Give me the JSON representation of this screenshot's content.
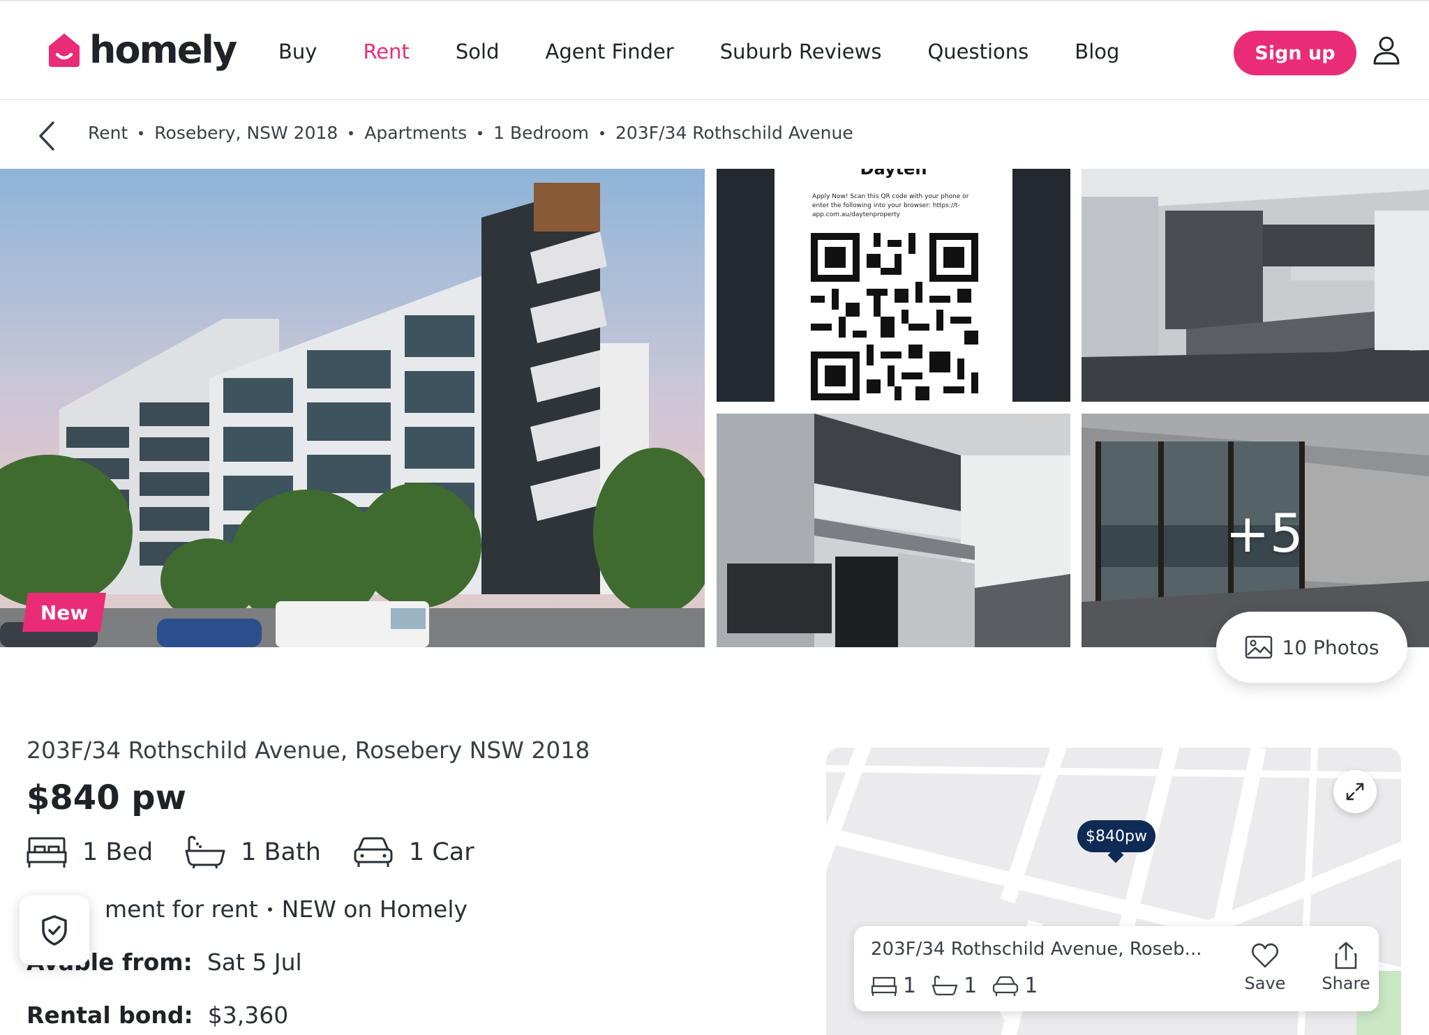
{
  "brand": {
    "name": "homely",
    "accent": "#ea2c76",
    "navy": "#0e2a55"
  },
  "nav": {
    "items": [
      {
        "label": "Buy",
        "active": false
      },
      {
        "label": "Rent",
        "active": true
      },
      {
        "label": "Sold",
        "active": false
      },
      {
        "label": "Agent Finder",
        "active": false
      },
      {
        "label": "Suburb Reviews",
        "active": false
      },
      {
        "label": "Questions",
        "active": false
      },
      {
        "label": "Blog",
        "active": false
      }
    ],
    "signup_label": "Sign up"
  },
  "breadcrumb": [
    "Rent",
    "Rosebery, NSW 2018",
    "Apartments",
    "1 Bedroom",
    "203F/34 Rothschild Avenue"
  ],
  "gallery": {
    "badge": "New",
    "more_count": "+5",
    "photos_label": "10 Photos",
    "flyer_text": "Apply Now! Scan this QR code with your phone or enter the following into your browser: https://t-app.com.au/daytenproperty",
    "flyer_header": "Dayten"
  },
  "listing": {
    "address": "203F/34 Rothschild Avenue, Rosebery NSW 2018",
    "price": "$840 pw",
    "beds": "1 Bed",
    "baths": "1 Bath",
    "cars": "1 Car",
    "type_text": "ment for rent",
    "status_text": "NEW on Homely",
    "available_label": "able from:",
    "available_prefix": "Av",
    "available_value": "Sat 5 Jul",
    "bond_label": "Rental bond:",
    "bond_value": "$3,360"
  },
  "map": {
    "pin_label": "$840pw",
    "card": {
      "address": "203F/34 Rothschild Avenue, Roseb...",
      "beds": "1",
      "baths": "1",
      "cars": "1",
      "save_label": "Save",
      "share_label": "Share"
    }
  }
}
